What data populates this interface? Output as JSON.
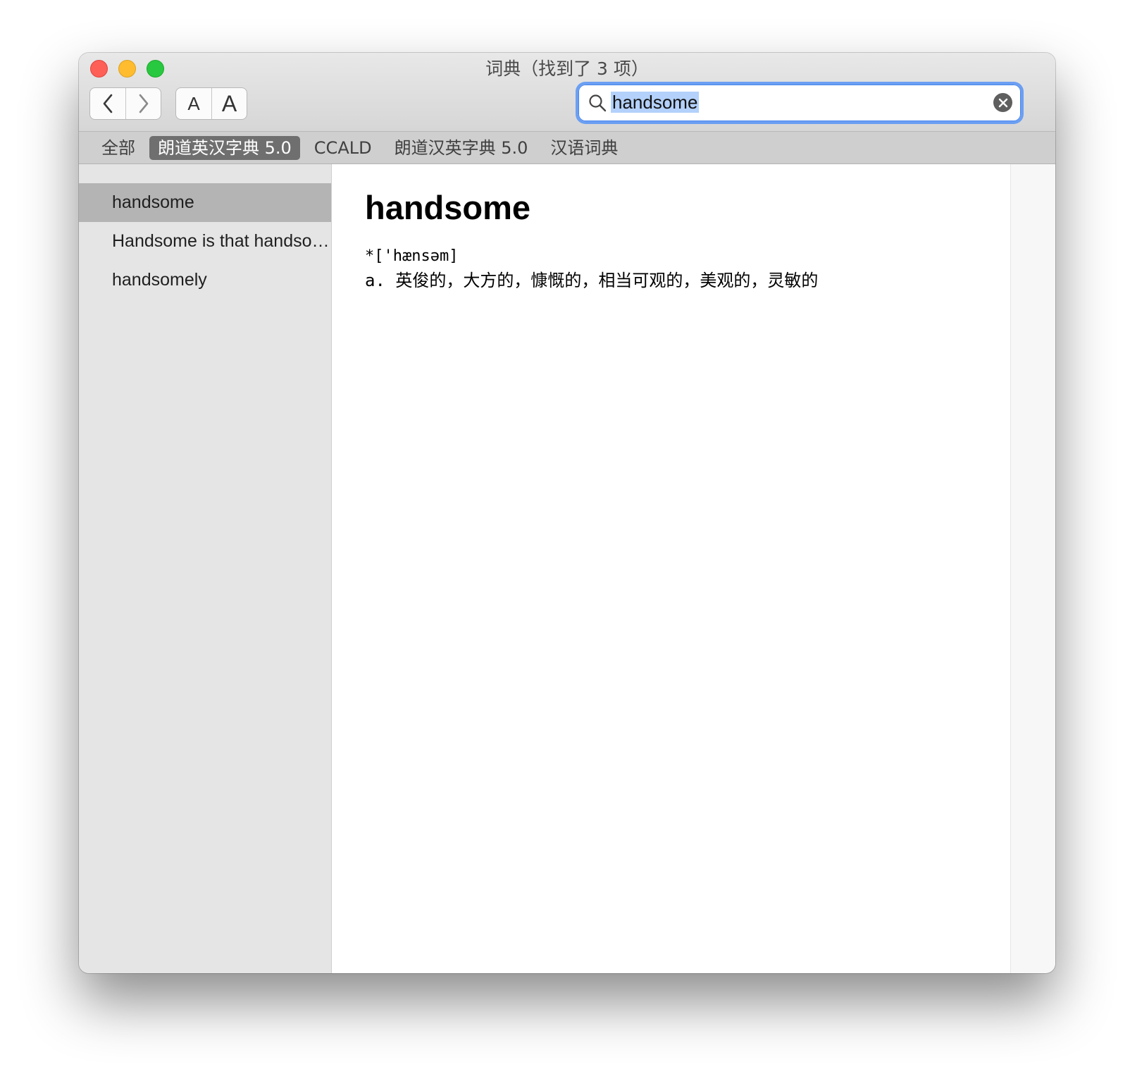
{
  "window": {
    "title": "词典（找到了 3 项）"
  },
  "toolbar": {
    "font_smaller_label": "A",
    "font_larger_label": "A"
  },
  "search": {
    "value": "handsome"
  },
  "dictionaries": [
    {
      "label": "全部",
      "active": false
    },
    {
      "label": "朗道英汉字典 5.0",
      "active": true
    },
    {
      "label": "CCALD",
      "active": false
    },
    {
      "label": "朗道汉英字典 5.0",
      "active": false
    },
    {
      "label": "汉语词典",
      "active": false
    }
  ],
  "results": [
    {
      "label": "handsome",
      "selected": true
    },
    {
      "label": "Handsome is that handsome does",
      "selected": false
    },
    {
      "label": "handsomely",
      "selected": false
    }
  ],
  "entry": {
    "headword": "handsome",
    "phonetic": "*['hænsəm]",
    "definition": "a. 英俊的，大方的，慷慨的，相当可观的，美观的，灵敏的"
  },
  "colors": {
    "accent": "#6b9ff3",
    "close": "#fe5f57",
    "minimize": "#febc2e",
    "maximize": "#28c840",
    "active_tab": "#6f6f6f",
    "selected_row": "#b4b4b4"
  }
}
